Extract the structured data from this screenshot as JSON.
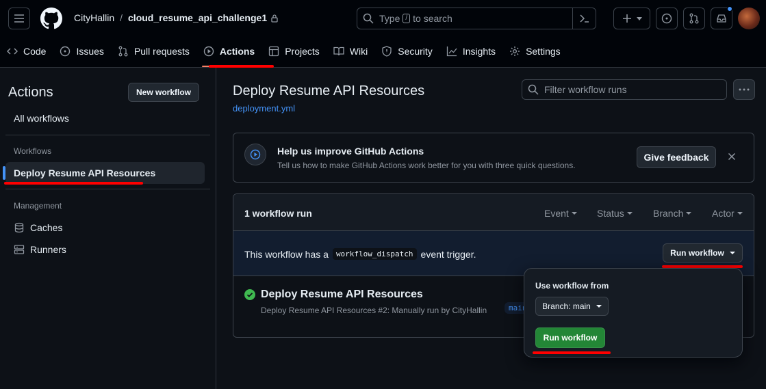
{
  "header": {
    "owner": "CityHallin",
    "separator": "/",
    "repo": "cloud_resume_api_challenge1",
    "search_pre": "Type",
    "search_key": "/",
    "search_post": "to search",
    "tabs": [
      {
        "label": "Code",
        "icon": "code-icon"
      },
      {
        "label": "Issues",
        "icon": "issue-icon"
      },
      {
        "label": "Pull requests",
        "icon": "pull-request-icon"
      },
      {
        "label": "Actions",
        "icon": "play-icon",
        "active": true
      },
      {
        "label": "Projects",
        "icon": "table-icon"
      },
      {
        "label": "Wiki",
        "icon": "book-icon"
      },
      {
        "label": "Security",
        "icon": "shield-icon"
      },
      {
        "label": "Insights",
        "icon": "graph-icon"
      },
      {
        "label": "Settings",
        "icon": "gear-icon"
      }
    ]
  },
  "sidebar": {
    "title": "Actions",
    "new_workflow": "New workflow",
    "all_workflows": "All workflows",
    "workflows_heading": "Workflows",
    "selected_workflow": "Deploy Resume API Resources",
    "management_heading": "Management",
    "caches": "Caches",
    "runners": "Runners"
  },
  "main": {
    "title": "Deploy Resume API Resources",
    "file": "deployment.yml",
    "filter_placeholder": "Filter workflow runs",
    "banner": {
      "title": "Help us improve GitHub Actions",
      "subtitle": "Tell us how to make GitHub Actions work better for you with three quick questions.",
      "feedback": "Give feedback"
    },
    "runs": {
      "count": "1 workflow run",
      "filters": [
        "Event",
        "Status",
        "Branch",
        "Actor"
      ],
      "dispatch_pre": "This workflow has a",
      "dispatch_code": "workflow_dispatch",
      "dispatch_post": "event trigger.",
      "run_workflow": "Run workflow",
      "run_title": "Deploy Resume API Resources",
      "run_subtitle": "Deploy Resume API Resources #2: Manually run by CityHallin",
      "run_branch": "main"
    },
    "popup": {
      "label": "Use workflow from",
      "branch": "Branch: main",
      "run": "Run workflow"
    }
  },
  "colors": {
    "accent": "#4493f8",
    "success": "#3fb950",
    "primary_button": "#238636",
    "annotation": "#ff0000"
  }
}
